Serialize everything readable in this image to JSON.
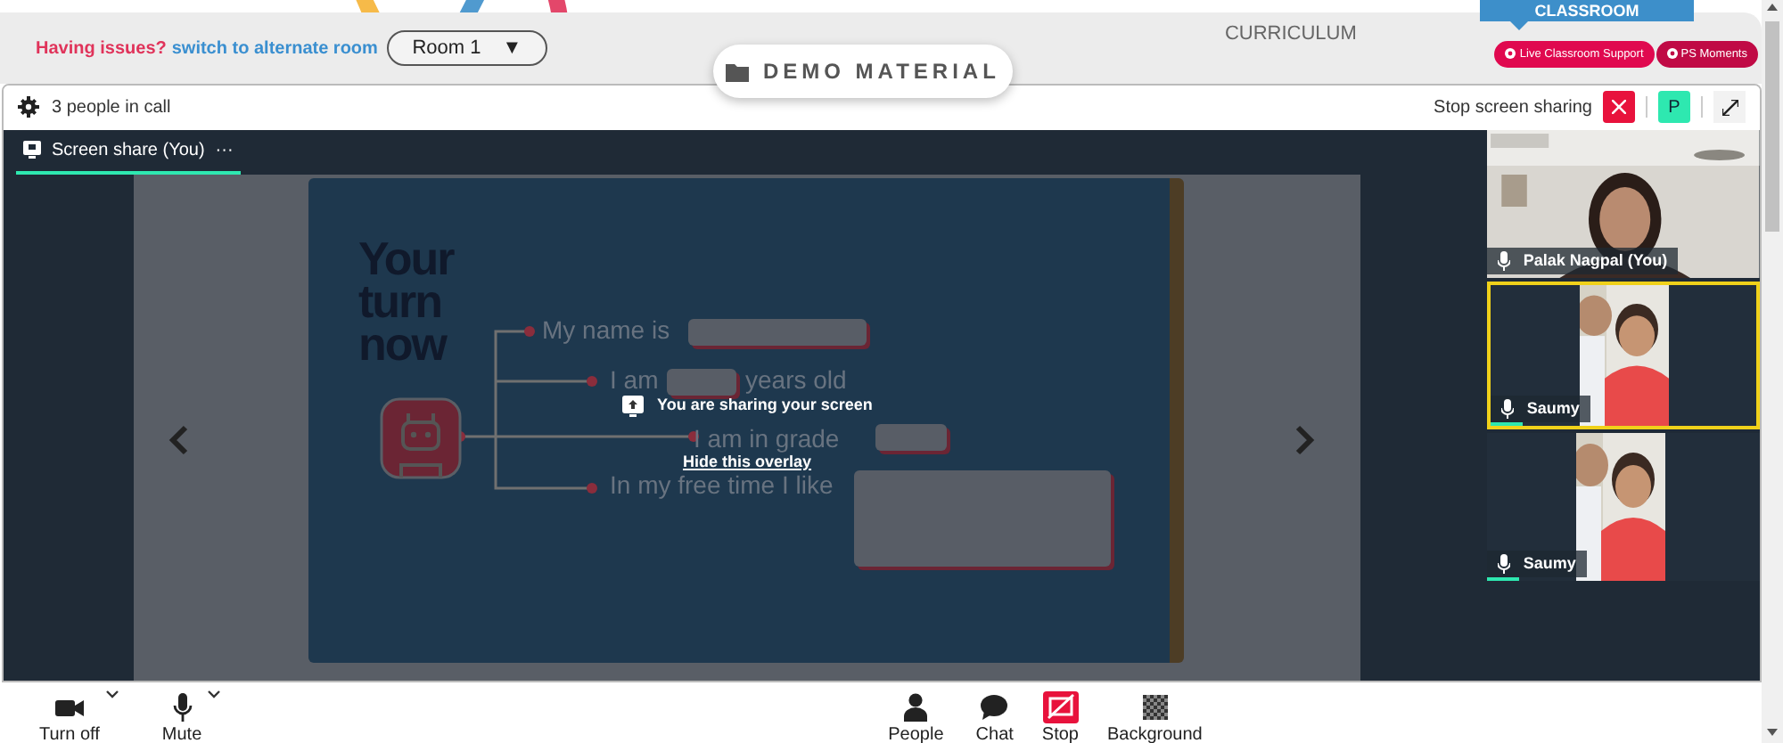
{
  "top_bar": {
    "issue_text": "Having issues?",
    "switch_link": "switch to alternate room",
    "room_select": {
      "value": "Room 1",
      "caret": "▼"
    },
    "demo_button": "DEMO MATERIAL",
    "curriculum_tab": "CURRICULUM",
    "classroom_banner": "CLASSROOM",
    "support_buttons": [
      {
        "label": "Live Classroom Support",
        "color": "#e0094f"
      },
      {
        "label": "PS Moments",
        "color": "#c00a45"
      }
    ]
  },
  "call_header": {
    "people_count": "3 people in call",
    "stop_share": "Stop screen sharing",
    "avatar_letter": "P"
  },
  "share_tab": {
    "label": "Screen share (You)",
    "menu": "···",
    "selected": true
  },
  "slide": {
    "title_lines": [
      "Your",
      "turn",
      "now"
    ],
    "prompts": [
      {
        "before": "My name is"
      },
      {
        "before": "I am",
        "after": "years old"
      },
      {
        "before": "I am in grade"
      },
      {
        "before": "In my free time I like"
      }
    ]
  },
  "overlay": {
    "message": "You are sharing your screen",
    "hide_link": "Hide this overlay"
  },
  "participants": [
    {
      "name": "Palak Nagpal (You)",
      "kind": "full",
      "speaking": false,
      "highlighted": false
    },
    {
      "name": "Saumy",
      "kind": "narrow",
      "speaking": true,
      "highlighted": true
    },
    {
      "name": "Saumy",
      "kind": "narrow",
      "speaking": true,
      "highlighted": false
    }
  ],
  "toolbar": [
    {
      "label": "Turn off",
      "kind": "camera",
      "dropdown": true
    },
    {
      "label": "Mute",
      "kind": "mic",
      "dropdown": true
    },
    {
      "label": "People",
      "kind": "people",
      "dropdown": false
    },
    {
      "label": "Chat",
      "kind": "chat",
      "dropdown": false
    },
    {
      "label": "Stop",
      "kind": "stop-share",
      "dropdown": false
    },
    {
      "label": "Background",
      "kind": "background",
      "dropdown": false
    }
  ]
}
